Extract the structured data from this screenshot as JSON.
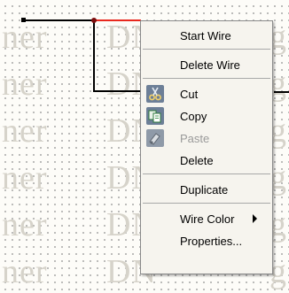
{
  "watermark": {
    "rows": [
      {
        "left": "ner",
        "right": "DN",
        "edge": "g"
      },
      {
        "left": "ner",
        "right": "DN",
        "edge": "g"
      },
      {
        "left": "ner",
        "right": "DN",
        "edge": "g"
      },
      {
        "left": "ner",
        "right": "DN",
        "edge": "g"
      },
      {
        "left": "ner",
        "right": "DN",
        "edge": "g"
      },
      {
        "left": "ner",
        "right": "DN",
        "edge": "g"
      }
    ]
  },
  "context_menu": {
    "items": [
      {
        "label": "Start Wire",
        "icon": "none",
        "enabled": true
      },
      {
        "label": "Delete Wire",
        "icon": "none",
        "enabled": true
      },
      {
        "label": "Cut",
        "icon": "scissors-icon",
        "enabled": true
      },
      {
        "label": "Copy",
        "icon": "copy-icon",
        "enabled": true
      },
      {
        "label": "Paste",
        "icon": "paste-icon",
        "enabled": false
      },
      {
        "label": "Delete",
        "icon": "none",
        "enabled": true
      },
      {
        "label": "Duplicate",
        "icon": "none",
        "enabled": true
      },
      {
        "label": "Wire Color",
        "icon": "none",
        "enabled": true,
        "submenu": true
      },
      {
        "label": "Properties...",
        "icon": "none",
        "enabled": true
      }
    ]
  },
  "colors": {
    "wire": "#000000",
    "selected_wire": "#e8281e",
    "node": "#7a0c0c",
    "menu_background": "#f6f4ee",
    "icon_tile": "#6d7f97"
  }
}
